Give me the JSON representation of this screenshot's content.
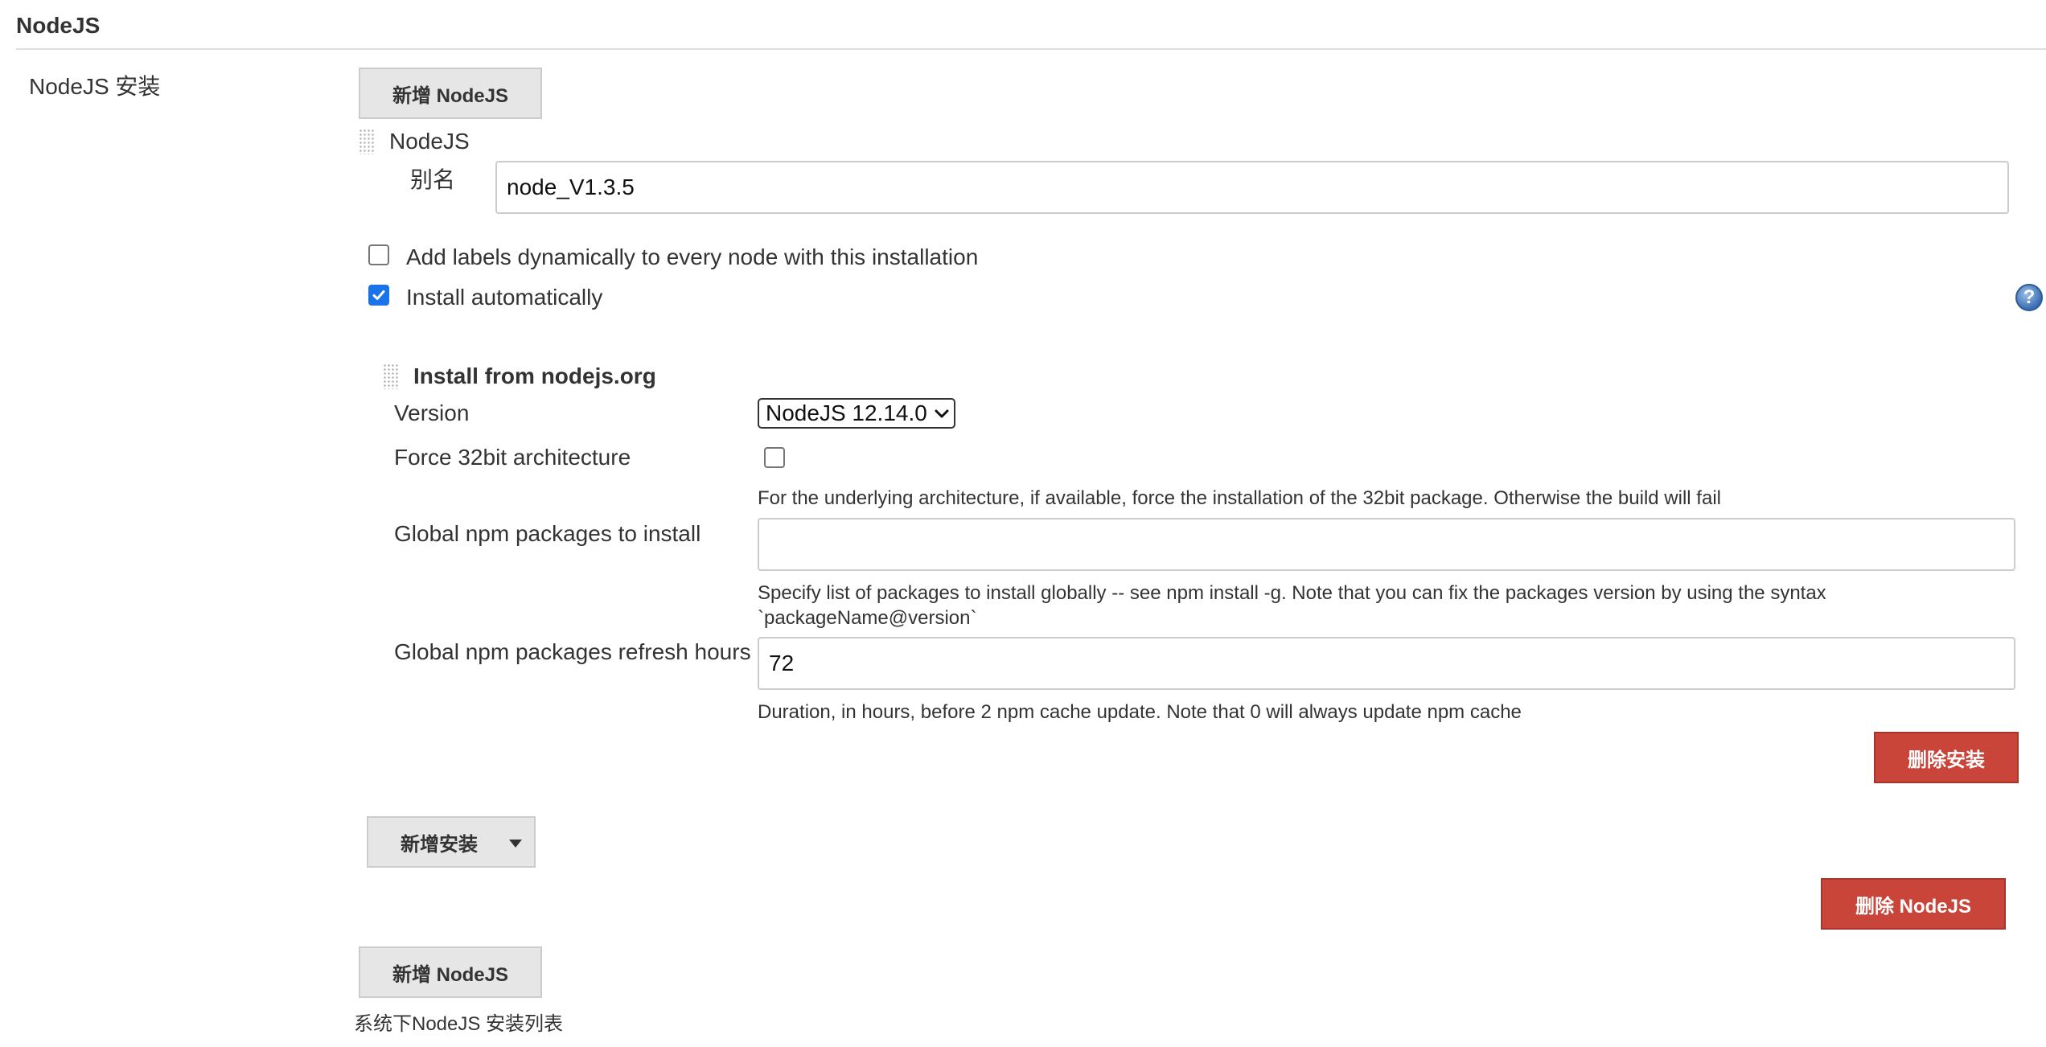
{
  "section": {
    "title": "NodeJS"
  },
  "installations": {
    "label": "NodeJS 安装",
    "add_button_top": "新增 NodeJS",
    "add_button_bottom": "新增 NodeJS",
    "list_description": "系统下NodeJS 安装列表",
    "entry": {
      "header": "NodeJS",
      "alias_label": "别名",
      "alias_value": "node_V1.3.5",
      "add_labels_checkbox": {
        "label": "Add labels dynamically to every node with this installation",
        "checked": false
      },
      "install_auto_checkbox": {
        "label": "Install automatically",
        "checked": true
      },
      "help_icon_glyph": "?",
      "installer": {
        "title": "Install from nodejs.org",
        "version_label": "Version",
        "version_value": "NodeJS 12.14.0",
        "force32_label": "Force 32bit architecture",
        "force32_checked": false,
        "force32_help": "For the underlying architecture, if available, force the installation of the 32bit package. Otherwise the build will fail",
        "npm_packages_label": "Global npm packages to install",
        "npm_packages_value": "",
        "npm_packages_help_line1": "Specify list of packages to install globally -- see npm install -g. Note that you can fix the packages version by using the syntax",
        "npm_packages_help_line2": "`packageName@version`",
        "refresh_label": "Global npm packages refresh hours",
        "refresh_value": "72",
        "refresh_help": "Duration, in hours, before 2 npm cache update. Note that 0 will always update npm cache",
        "delete_installer_button": "删除安装"
      },
      "add_installer_button": "新增安装",
      "delete_nodejs_button": "删除 NodeJS"
    }
  },
  "colors": {
    "danger": "#c9453a",
    "checkbox_checked": "#1a73e8"
  },
  "icons": {
    "dropdown": "caret-down-icon",
    "help": "help-icon",
    "drag": "drag-handle-icon",
    "check": "checkmark-icon"
  }
}
